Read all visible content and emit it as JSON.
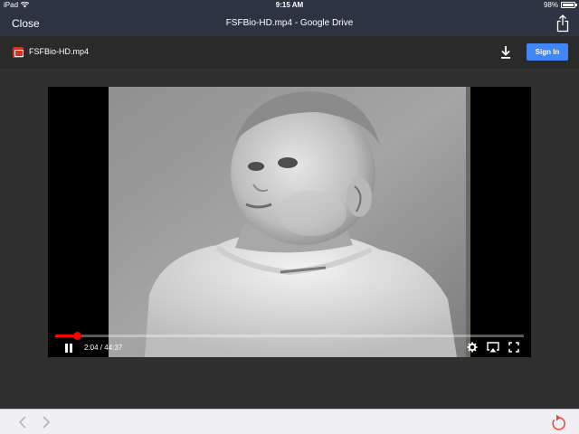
{
  "status_bar": {
    "device": "iPad",
    "time": "9:15 AM",
    "battery": "98%"
  },
  "nav": {
    "close_label": "Close",
    "title": "FSFBio-HD.mp4 - Google Drive"
  },
  "drive_header": {
    "file_name": "FSFBio-HD.mp4",
    "sign_in_label": "Sign In"
  },
  "player": {
    "current_time": "2:04",
    "duration": "44:37",
    "time_display": "2:04 / 44:37",
    "progress_fraction": 0.046,
    "state": "playing"
  },
  "colors": {
    "nav_bg": "#2b3440",
    "accent": "#4285f4",
    "progress": "#ff0000",
    "reload_icon": "#e8453c"
  },
  "icons": [
    "wifi-icon",
    "battery-icon",
    "share-icon",
    "video-file-icon",
    "download-icon",
    "pause-icon",
    "gear-icon",
    "airplay-icon",
    "fullscreen-icon",
    "back-arrow-icon",
    "forward-arrow-icon",
    "reload-icon"
  ]
}
